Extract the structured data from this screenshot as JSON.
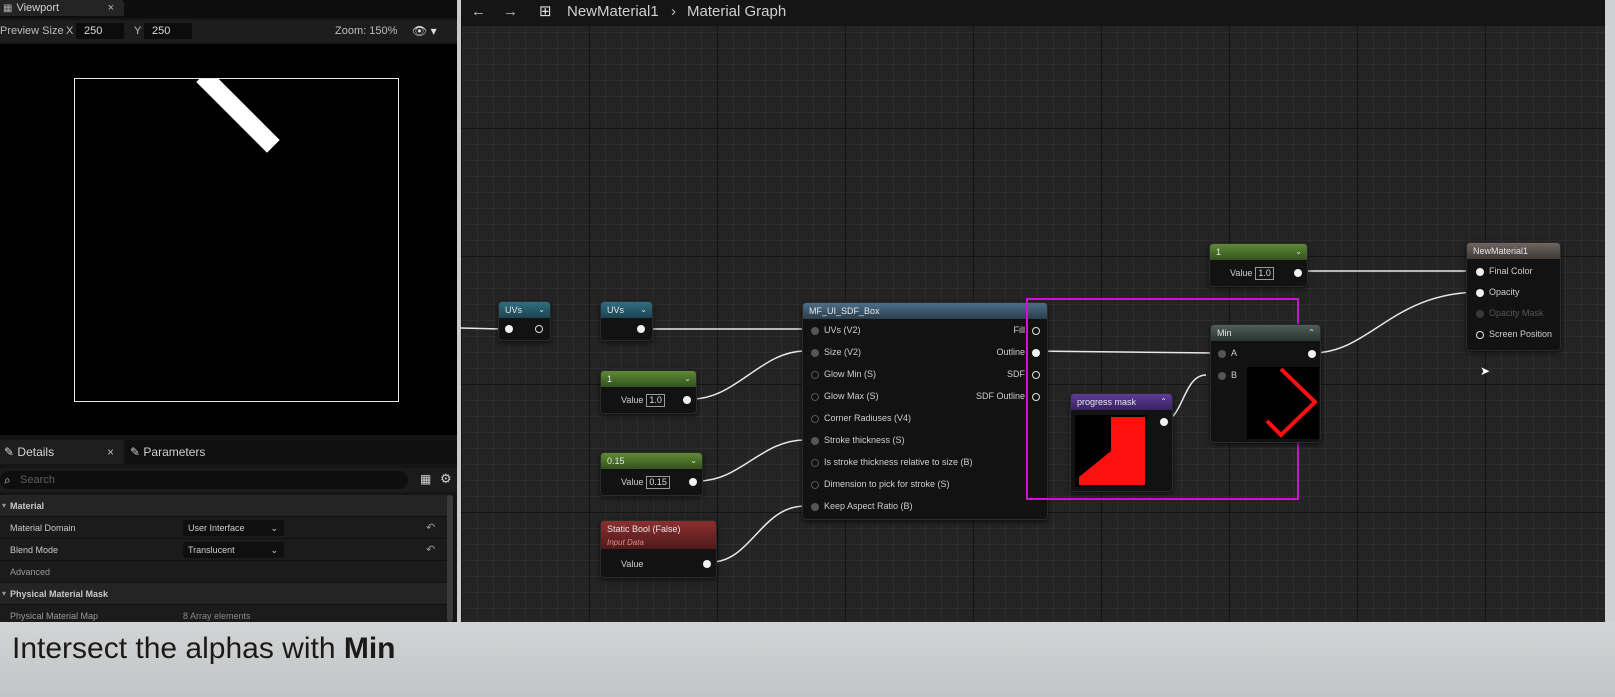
{
  "viewport": {
    "tab_label": "Viewport",
    "preview_size_label": "Preview Size",
    "x_label": "X",
    "x_value": "250",
    "y_label": "Y",
    "y_value": "250",
    "zoom": "Zoom: 150%"
  },
  "details": {
    "tab_details": "Details",
    "tab_parameters": "Parameters",
    "search_placeholder": "Search",
    "rows": {
      "material": "Material",
      "material_domain_label": "Material Domain",
      "material_domain_value": "User Interface",
      "blend_mode_label": "Blend Mode",
      "blend_mode_value": "Translucent",
      "advanced": "Advanced",
      "physical_material_mask": "Physical Material Mask",
      "physical_material_map_label": "Physical Material Map",
      "physical_material_map_value": "8 Array elements"
    }
  },
  "graph": {
    "breadcrumb": [
      "NewMaterial1",
      "Material Graph"
    ],
    "nodes": {
      "uvs1": {
        "title": "UVs"
      },
      "uvs2": {
        "title": "UVs"
      },
      "const_size": {
        "title": "1",
        "value_label": "Value",
        "value": "1.0"
      },
      "const_stroke": {
        "title": "0.15",
        "value_label": "Value",
        "value": "0.15"
      },
      "static_bool": {
        "title": "Static Bool (False)",
        "subtitle": "Input Data",
        "value_label": "Value"
      },
      "sdf_box": {
        "title": "MF_UI_SDF_Box",
        "inputs": [
          "UVs (V2)",
          "Size (V2)",
          "Glow Min (S)",
          "Glow Max (S)",
          "Corner Radiuses (V4)",
          "Stroke thickness (S)",
          "Is stroke thickness relative to size (B)",
          "Dimension to pick for stroke (S)",
          "Keep Aspect Ratio (B)"
        ],
        "outputs": [
          "Fill",
          "Outline",
          "SDF",
          "SDF Outline"
        ]
      },
      "progress_mask": {
        "title": "progress mask"
      },
      "min": {
        "title": "Min",
        "inputs": [
          "A",
          "B"
        ]
      },
      "const_color": {
        "title": "1",
        "value_label": "Value",
        "value": "1.0"
      },
      "result": {
        "title": "NewMaterial1",
        "inputs": [
          "Final Color",
          "Opacity",
          "Opacity Mask",
          "Screen Position"
        ]
      }
    }
  },
  "caption": {
    "text": "Intersect the alphas with ",
    "bold": "Min"
  },
  "colors": {
    "selection": "#d010d8",
    "preview_red": "#ff1010"
  }
}
